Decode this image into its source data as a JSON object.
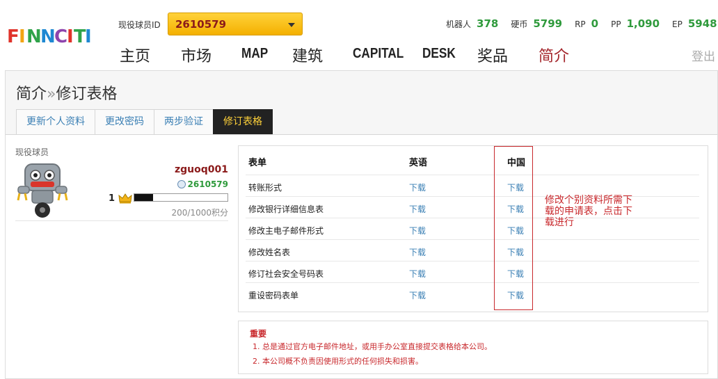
{
  "header": {
    "logo_text": "FINNCITI",
    "player_id_label": "现役球员ID",
    "player_id_value": "2610579",
    "stats": [
      {
        "label": "机器人",
        "value": "378"
      },
      {
        "label": "硬币",
        "value": "5799"
      },
      {
        "label": "RP",
        "value": "0"
      },
      {
        "label": "PP",
        "value": "1,090"
      },
      {
        "label": "EP",
        "value": "5948"
      }
    ],
    "nav": [
      {
        "label": "主页"
      },
      {
        "label": "市场"
      },
      {
        "label": "MAP"
      },
      {
        "label": "建筑"
      },
      {
        "label": "CAPITAL"
      },
      {
        "label": "DESK"
      },
      {
        "label": "奖品"
      },
      {
        "label": "简介"
      }
    ],
    "logout_label": "登出"
  },
  "page": {
    "breadcrumb_parent": "简介",
    "breadcrumb_sep": "»",
    "breadcrumb_current": "修订表格",
    "tabs": [
      {
        "label": "更新个人资料"
      },
      {
        "label": "更改密码"
      },
      {
        "label": "两步验证"
      },
      {
        "label": "修订表格"
      }
    ]
  },
  "profile": {
    "label": "现役球员",
    "username": "zguoq001",
    "player_id": "2610579",
    "level": "1",
    "xp_progress": 0.2,
    "xp_text": "200/1000积分"
  },
  "forms": {
    "col_form": "表单",
    "col_english": "英语",
    "col_chinese": "中国",
    "download_label": "下载",
    "rows": [
      {
        "name": "转账形式"
      },
      {
        "name": "修改银行详细信息表"
      },
      {
        "name": "修改主电子邮件形式"
      },
      {
        "name": "修改姓名表"
      },
      {
        "name": "修订社会安全号码表"
      },
      {
        "name": "重设密码表单"
      }
    ],
    "annotation": "修改个别资料所需下载的申请表，点击下载进行"
  },
  "notice": {
    "title": "重要",
    "items": [
      "1.  总是通过官方电子邮件地址，或用手办公室直接提交表格给本公司。",
      "2.  本公司概不负责因使用形式的任何损失和损害。"
    ]
  },
  "colors": {
    "accent_gold": "#ffd23a",
    "stat_green": "#2f9a3c",
    "brand_red": "#a4262c",
    "link_blue": "#3a7fb4",
    "notice_red": "#c8282c"
  }
}
